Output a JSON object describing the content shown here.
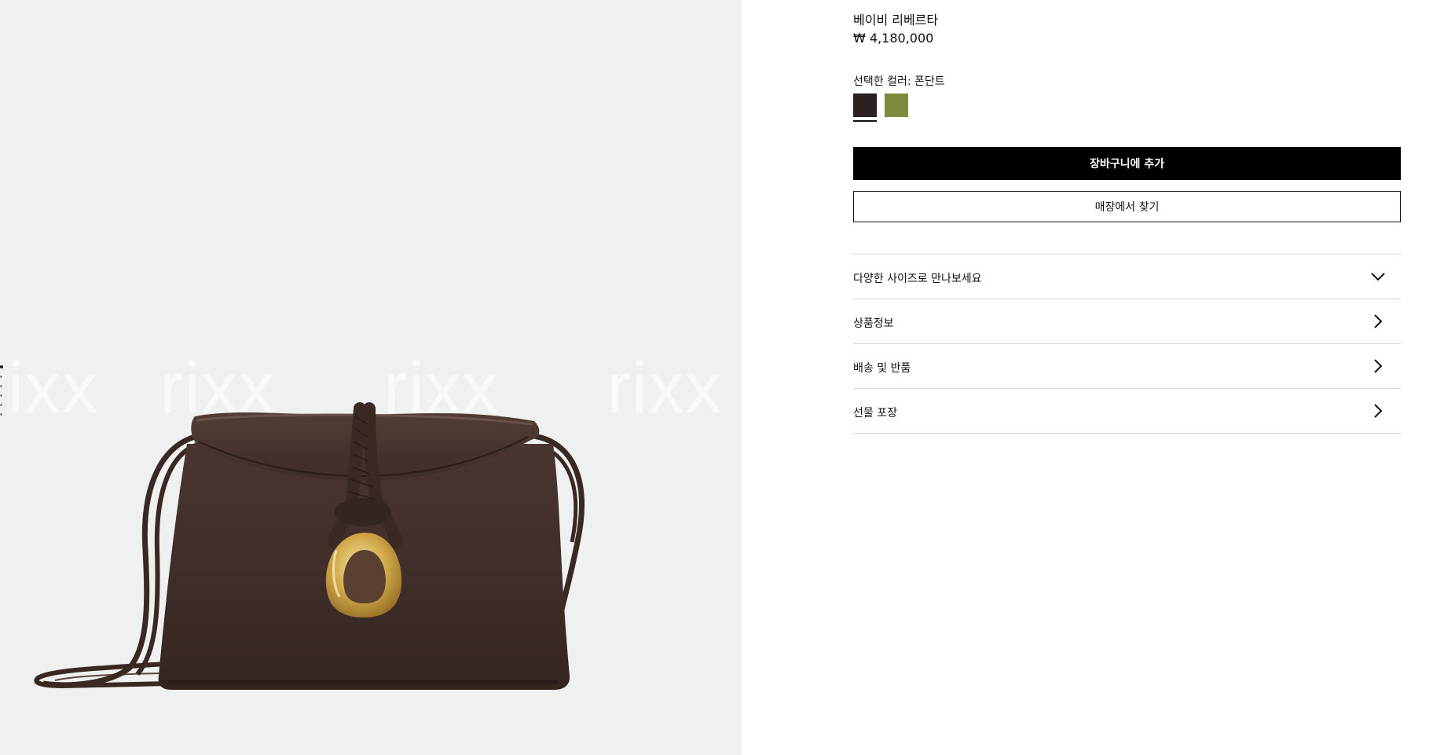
{
  "product": {
    "name": "베이비 리베르타",
    "price": "₩ 4,180,000"
  },
  "image": {
    "watermark_text": "rixx",
    "background_color": "#eff1f0",
    "bag_color": "#4a3530"
  },
  "color_selector": {
    "label": "선택한 컬러: 폰단트",
    "swatches": [
      {
        "name": "fondant",
        "hex": "#2c2120",
        "selected": true
      },
      {
        "name": "olive",
        "hex": "#7c8a3d",
        "selected": false
      }
    ]
  },
  "actions": {
    "add_to_cart": "장바구니에 추가",
    "find_in_store": "매장에서 찾기"
  },
  "accordion": {
    "items": [
      {
        "label": "다양한 사이즈로 만나보세요",
        "icon": "chevron-down-icon"
      },
      {
        "label": "상품정보",
        "icon": "chevron-right-icon"
      },
      {
        "label": "배송 및 반품",
        "icon": "chevron-right-icon"
      },
      {
        "label": "선물 포장",
        "icon": "chevron-right-icon"
      }
    ]
  },
  "colors": {
    "primary_button_bg": "#000000",
    "primary_button_text": "#ffffff",
    "divider": "#d6d6d6"
  }
}
